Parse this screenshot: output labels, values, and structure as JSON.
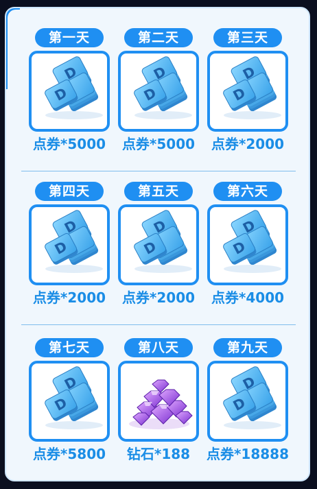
{
  "colors": {
    "accent": "#1f8ff2",
    "reward_text": "#1a8de6",
    "panel_bg": "#f0f7fd",
    "coupon_icon": "#4fb3ee",
    "diamond_icon": "#9b4fe0"
  },
  "rewards": [
    {
      "day": "第一天",
      "reward": "点券*5000",
      "icon": "coupon-stack-icon"
    },
    {
      "day": "第二天",
      "reward": "点券*5000",
      "icon": "coupon-stack-icon"
    },
    {
      "day": "第三天",
      "reward": "点券*2000",
      "icon": "coupon-stack-icon"
    },
    {
      "day": "第四天",
      "reward": "点券*2000",
      "icon": "coupon-stack-icon"
    },
    {
      "day": "第五天",
      "reward": "点券*2000",
      "icon": "coupon-stack-icon"
    },
    {
      "day": "第六天",
      "reward": "点券*4000",
      "icon": "coupon-stack-icon"
    },
    {
      "day": "第七天",
      "reward": "点券*5800",
      "icon": "coupon-stack-icon"
    },
    {
      "day": "第八天",
      "reward": "钻石*188",
      "icon": "diamond-pile-icon"
    },
    {
      "day": "第九天",
      "reward": "点券*18888",
      "icon": "coupon-stack-icon"
    }
  ]
}
